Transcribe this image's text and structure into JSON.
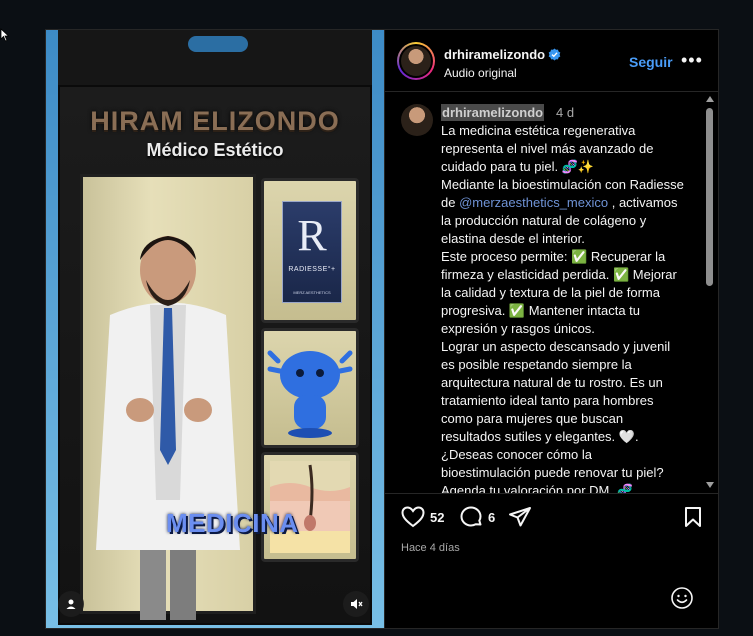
{
  "post": {
    "overlay_name": "HIRAM ELIZONDO",
    "overlay_role": "Médico Estético",
    "product_letter": "R",
    "product_label": "RADIESSE°+",
    "product_brand": "MERZ AESTHETICS",
    "overlay_word": "MEDICINA"
  },
  "header": {
    "username": "drhiramelizondo",
    "subtitle": "Audio original",
    "follow_label": "Seguir",
    "more_label": "•••"
  },
  "caption": {
    "username": "drhiramelizondo",
    "time": "4 d",
    "part1": "La medicina estética regenerativa representa el nivel más avanzado de cuidado para tu piel. 🧬✨\nMediante la bioestimulación con Radiesse de ",
    "mention": "@merzaesthetics_mexico",
    "part2": " , activamos la producción natural de colágeno y elastina desde el interior.\nEste proceso permite: ✅ Recuperar la firmeza y elasticidad perdida. ✅ Mejorar la calidad y textura de la piel de forma progresiva. ✅ Mantener intacta tu expresión y rasgos únicos.\nLograr un aspecto descansado y juvenil es posible respetando siempre la arquitectura natural de tu rostro. Es un tratamiento ideal tanto para hombres como para mujeres que buscan resultados sutiles y elegantes. 🤍.\n¿Deseas conocer cómo la bioestimulación puede renovar tu piel? Agenda tu valoración por DM. 🧬"
  },
  "actions": {
    "likes": "52",
    "comments": "6"
  },
  "date_label": "Hace 4 días",
  "colors": {
    "accent": "#4a9df8",
    "verified": "#3897f0",
    "mention": "#6f93d6"
  }
}
